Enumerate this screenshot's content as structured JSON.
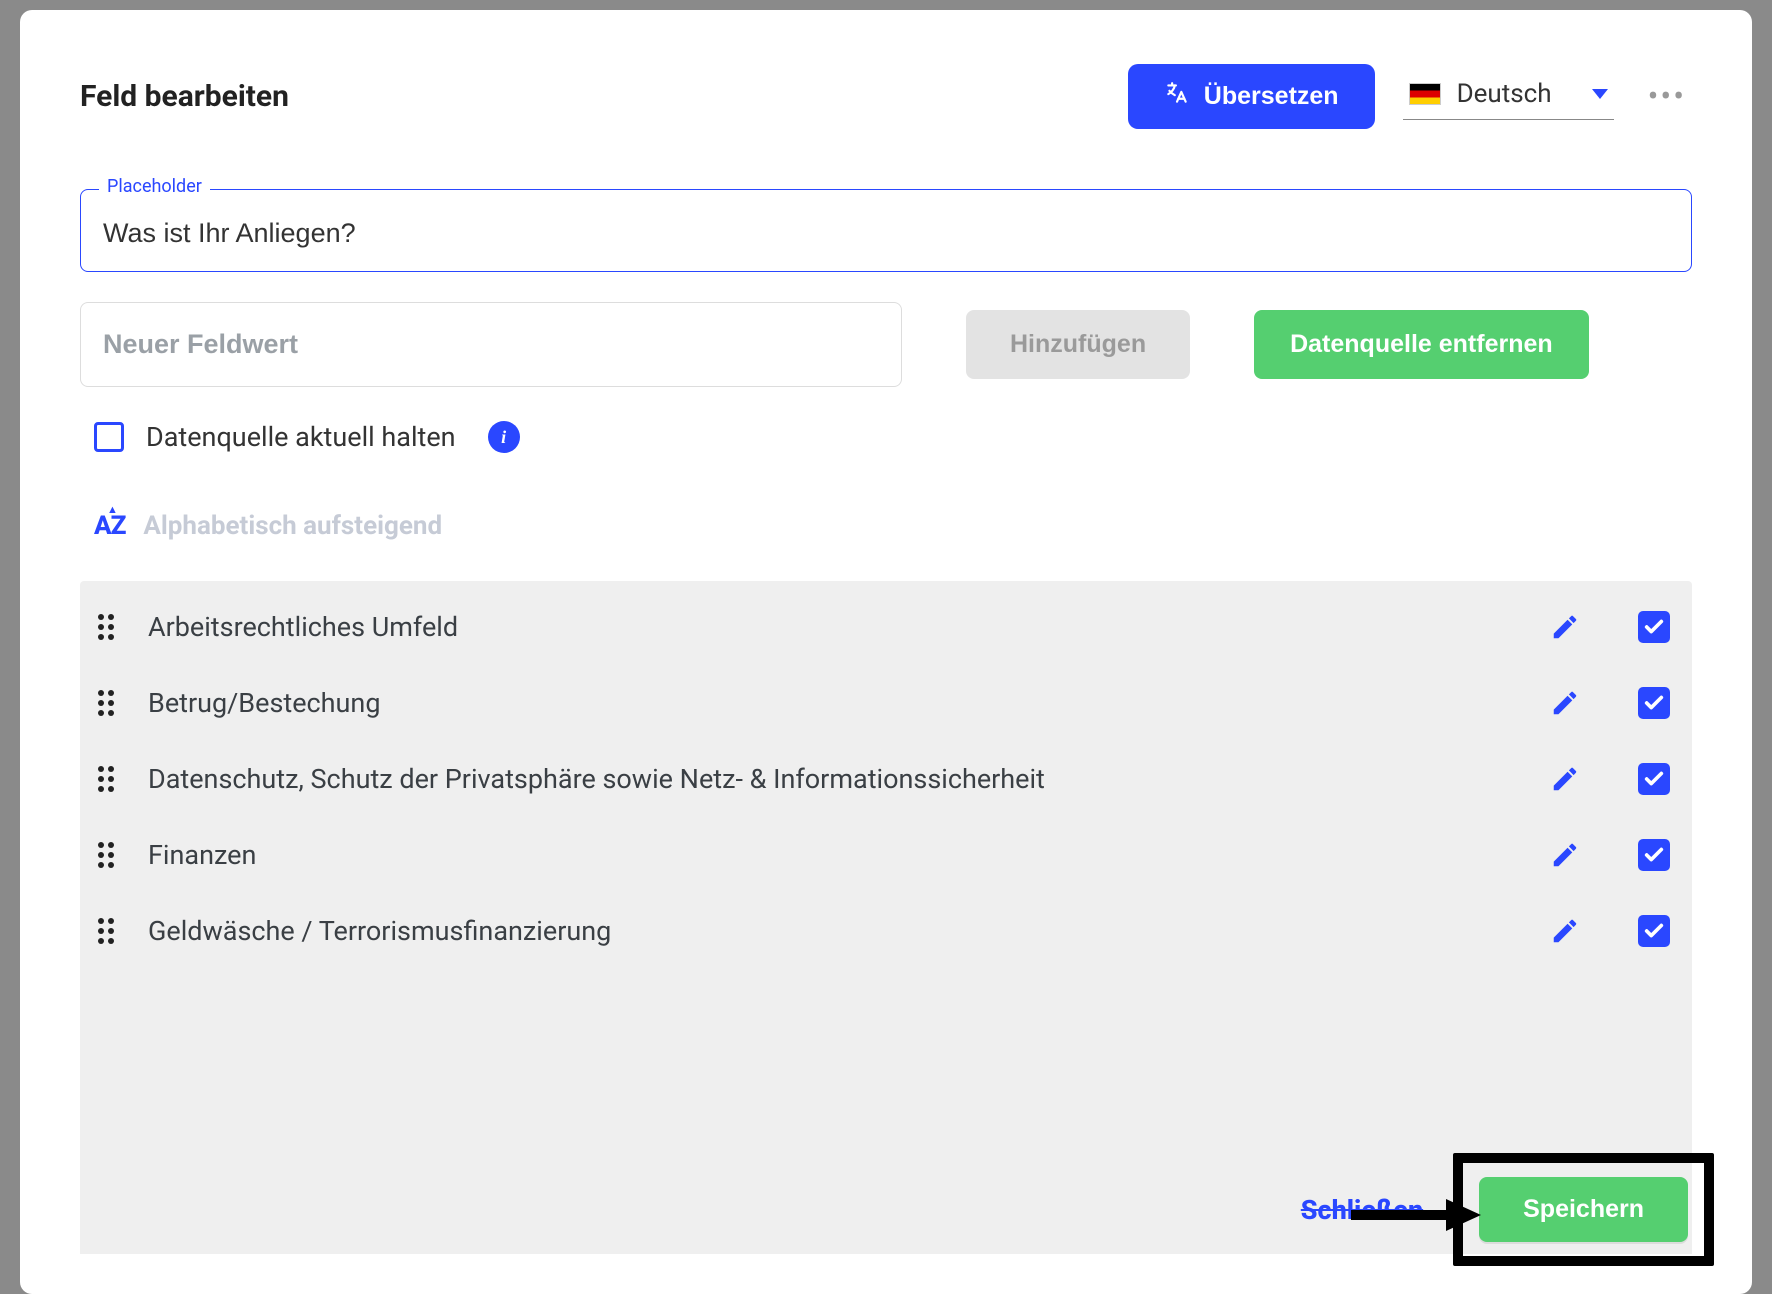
{
  "header": {
    "title": "Feld bearbeiten",
    "translate_label": "Übersetzen",
    "language_label": "Deutsch"
  },
  "placeholder_field": {
    "legend": "Placeholder",
    "value": "Was ist Ihr Anliegen?"
  },
  "new_value": {
    "placeholder": "Neuer Feldwert",
    "add_label": "Hinzufügen",
    "remove_ds_label": "Datenquelle entfernen"
  },
  "keep_current": {
    "label": "Datenquelle aktuell halten"
  },
  "sort": {
    "label": "Alphabetisch aufsteigend"
  },
  "options": [
    {
      "label": "Arbeitsrechtliches Umfeld",
      "checked": true
    },
    {
      "label": "Betrug/Bestechung",
      "checked": true
    },
    {
      "label": "Datenschutz, Schutz der Privatsphäre sowie Netz- & Informationssicherheit",
      "checked": true
    },
    {
      "label": "Finanzen",
      "checked": true
    },
    {
      "label": "Geldwäsche / Terrorismusfinanzierung",
      "checked": true
    }
  ],
  "footer": {
    "close_label": "Schließen",
    "save_label": "Speichern"
  }
}
